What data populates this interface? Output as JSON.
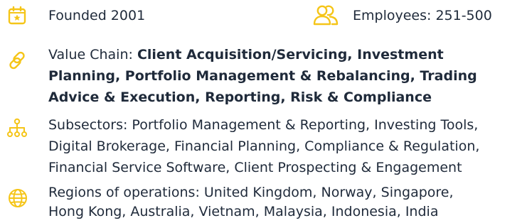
{
  "company_facts": {
    "founded": "Founded 2001",
    "employees": "Employees: 251-500",
    "value_chain": {
      "label": "Value Chain: ",
      "value_line1": "Client Acquisition/Servicing, Investment",
      "value_line2": "Planning, Portfolio Management & Rebalancing, Trading",
      "value_line3": "Advice & Execution, Reporting, Risk & Compliance"
    },
    "subsectors": {
      "line1": "Subsectors: Portfolio Management & Reporting, Investing Tools,",
      "line2": "Digital Brokerage, Financial Planning,  Compliance & Regulation,",
      "line3": "Financial Service Software, Client Prospecting & Engagement"
    },
    "regions": {
      "line1": "Regions of operations: United Kingdom, Norway, Singapore,",
      "line2": "Hong Kong, Australia, Vietnam, Malaysia, Indonesia, India"
    }
  },
  "icons": {
    "founded": "calendar-star-icon",
    "employees": "people-icon",
    "value_chain": "link-icon",
    "subsectors": "org-chart-icon",
    "regions": "globe-icon"
  },
  "colors": {
    "accent": "#F5C518",
    "text": "#1F2A3A"
  }
}
